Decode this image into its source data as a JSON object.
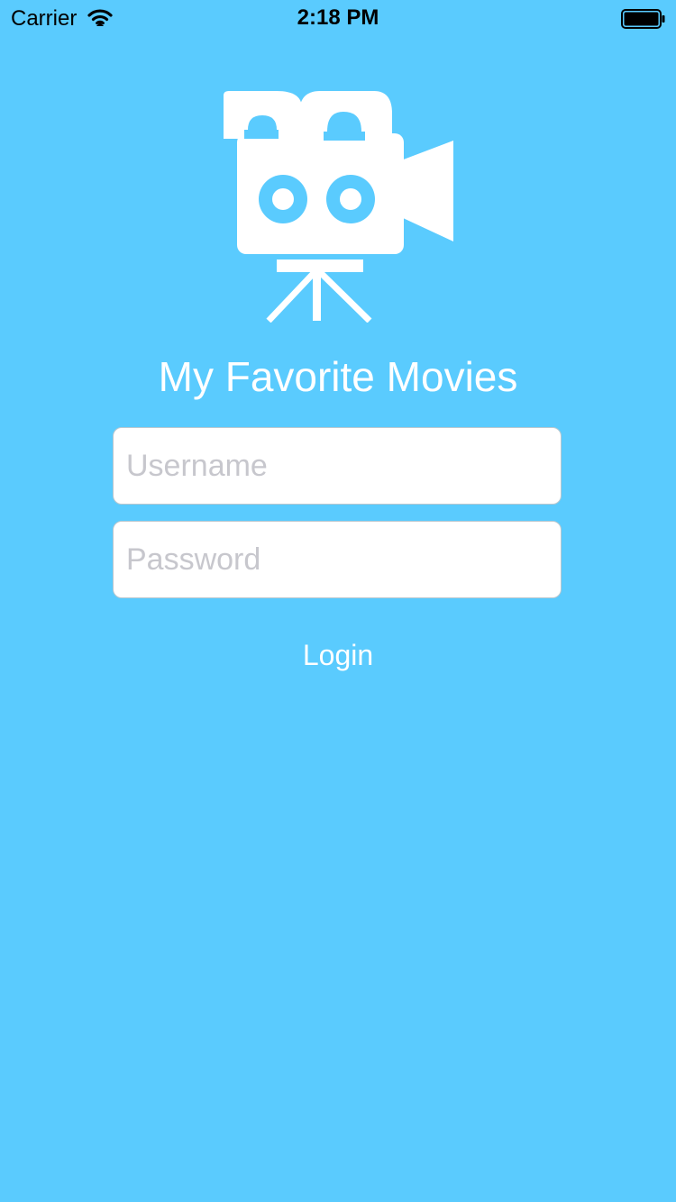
{
  "status_bar": {
    "carrier": "Carrier",
    "time": "2:18 PM",
    "wifi_icon": "wifi-icon",
    "battery_icon": "battery-icon"
  },
  "app": {
    "logo_icon": "movie-camera-icon",
    "title": "My Favorite Movies"
  },
  "form": {
    "username_placeholder": "Username",
    "username_value": "",
    "password_placeholder": "Password",
    "password_value": "",
    "login_label": "Login"
  },
  "colors": {
    "background": "#5ACBFE",
    "foreground": "#FFFFFF",
    "placeholder": "#C7C7CD"
  }
}
